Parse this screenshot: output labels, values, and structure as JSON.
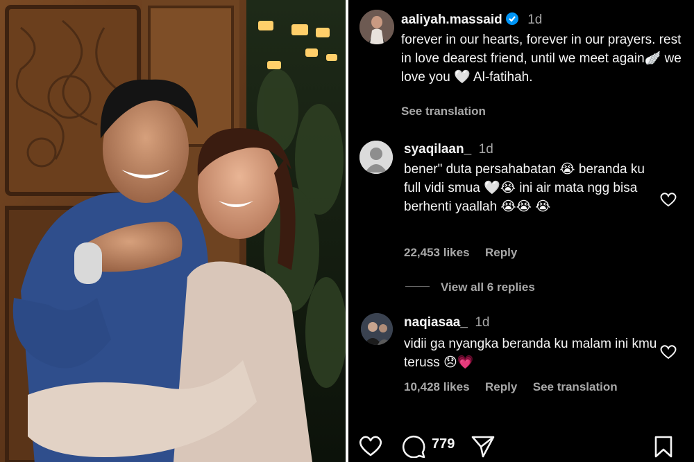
{
  "caption": {
    "username": "aaliyah.massaid",
    "time": "1d",
    "text": "forever in our hearts, forever in our prayers. rest in love dearest friend, until we meet again🪽 we love you 🤍 Al-fatihah.",
    "see_translation": "See translation"
  },
  "comments": [
    {
      "username": "syaqilaan_",
      "time": "1d",
      "text": "bener\" duta persahabatan 😭 beranda ku full vidi smua 🤍😭 ini air mata ngg bisa berhenti yaallah 😭😭 😭",
      "likes": "22,453 likes",
      "reply": "Reply",
      "view_replies": "View all 6 replies"
    },
    {
      "username": "naqiasaa_",
      "time": "1d",
      "text": "vidii ga nyangka beranda ku malam ini kmu teruss 😞💗",
      "likes": "10,428 likes",
      "reply": "Reply",
      "see_translation": "See translation"
    }
  ],
  "actions": {
    "comment_count": "779",
    "icons": [
      "heart-icon",
      "comment-icon",
      "share-icon",
      "bookmark-icon"
    ]
  },
  "colors": {
    "panel_bg": "#000000",
    "text": "#f5f5f5",
    "muted": "#a8a8a8",
    "verified": "#0095f6"
  }
}
